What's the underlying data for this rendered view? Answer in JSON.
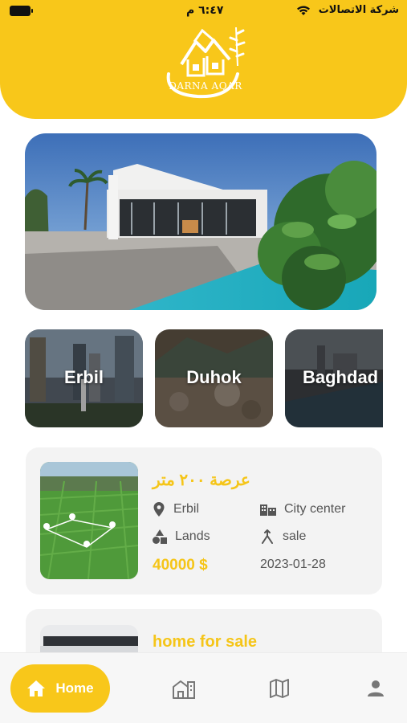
{
  "status_bar": {
    "carrier": "شركة الاتصالات",
    "time": "٦:٤٧ م"
  },
  "header": {
    "logo_text": "DARNA AQAR",
    "brand_color": "#f8c71a"
  },
  "cities": [
    {
      "name": "Erbil"
    },
    {
      "name": "Duhok"
    },
    {
      "name": "Baghdad"
    }
  ],
  "listings": [
    {
      "title": "عرصة ٢٠٠ متر",
      "location": "Erbil",
      "area": "City center",
      "category": "Lands",
      "deal_type": "sale",
      "price": "40000 $",
      "date": "2023-01-28",
      "icons": {
        "location": "location-pin-icon",
        "area": "buildings-icon",
        "category": "shapes-icon",
        "deal": "handshake-icon"
      }
    },
    {
      "title": "home for sale"
    }
  ],
  "bottom_nav": {
    "home_label": "Home",
    "active_color": "#f8c71a",
    "icons": [
      "home-icon",
      "properties-icon",
      "map-icon",
      "profile-icon"
    ]
  }
}
